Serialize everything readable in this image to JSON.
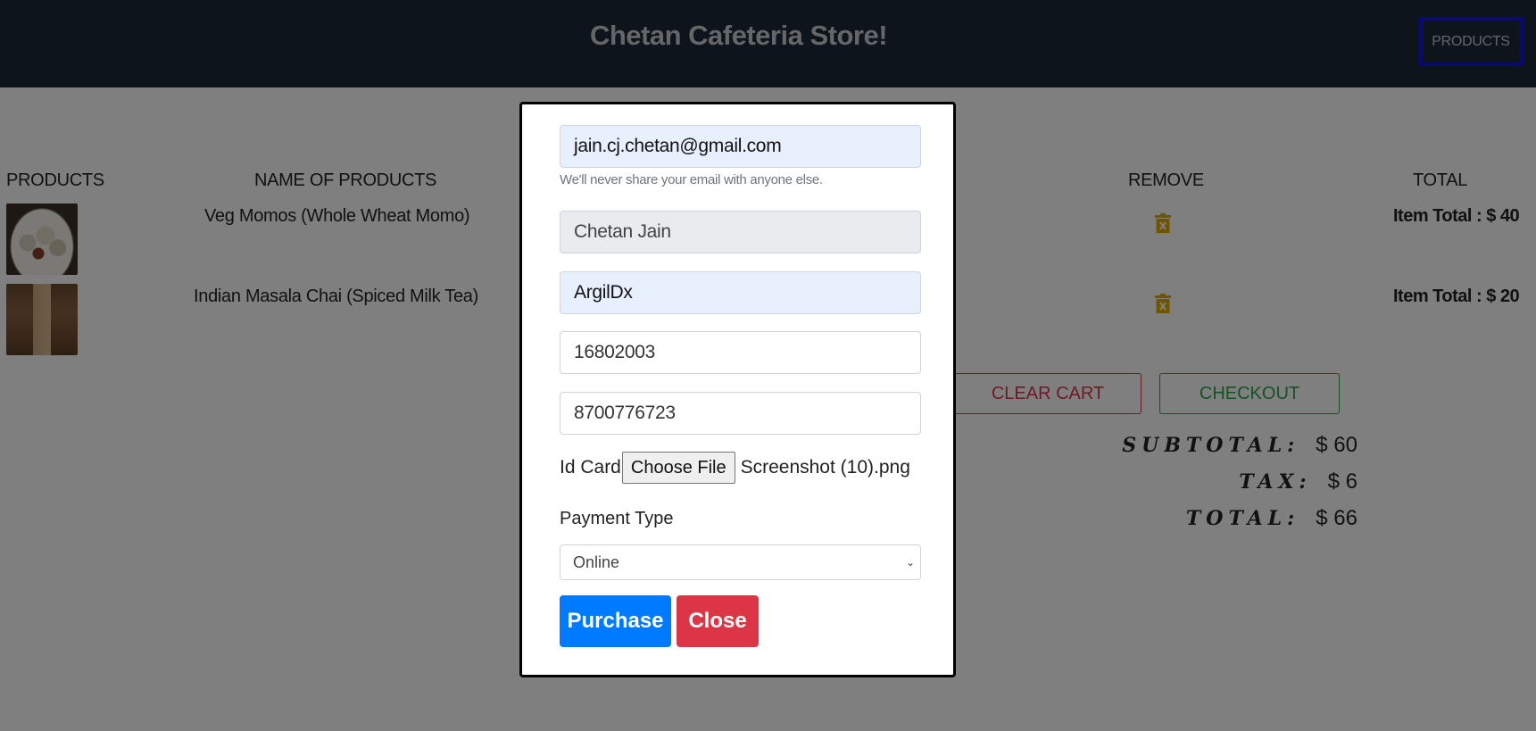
{
  "navbar": {
    "title": "Chetan Cafeteria Store!",
    "products_button": "PRODUCTS"
  },
  "table": {
    "headers": [
      "PRODUCTS",
      "NAME OF PRODUCTS",
      "REMOVE",
      "TOTAL"
    ],
    "rows": [
      {
        "name": "Veg Momos (Whole Wheat Momo)",
        "total": "Item Total : $ 40"
      },
      {
        "name": "Indian Masala Chai (Spiced Milk Tea)",
        "total": "Item Total : $ 20"
      }
    ]
  },
  "cart_actions": {
    "clear": "CLEAR CART",
    "checkout": "CHECKOUT"
  },
  "summary": {
    "subtotal_label": "SUBTOTAL:",
    "subtotal_value": "$ 60",
    "tax_label": "TAX:",
    "tax_value": "$ 6",
    "total_label": "TOTAL:",
    "total_value": "$ 66"
  },
  "modal": {
    "email": "jain.cj.chetan@gmail.com",
    "email_help": "We'll never share your email with anyone else.",
    "name": "Chetan Jain",
    "id_field": "ArgilDx",
    "number_field": "16802003",
    "phone": "8700776723",
    "id_card_label": "Id Card",
    "choose_file": "Choose File",
    "file_name": "Screenshot (10).png",
    "payment_label": "Payment Type",
    "payment_value": "Online",
    "purchase": "Purchase",
    "close": "Close"
  },
  "colors": {
    "navbar": "#1c2838",
    "danger": "#dc3545",
    "success": "#28a745",
    "primary": "#007bff",
    "trash": "#e0a800"
  },
  "icons": {
    "remove": "trash-icon"
  }
}
